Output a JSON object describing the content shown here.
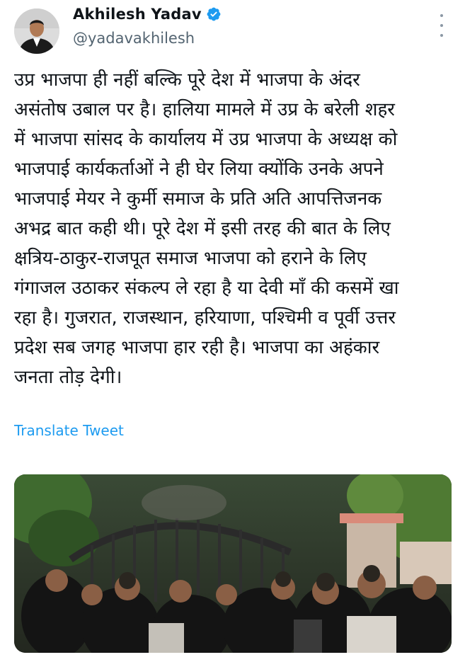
{
  "author": {
    "name": "Akhilesh Yadav",
    "handle": "@yadavakhilesh",
    "verified": true,
    "avatar_icon": "profile-photo"
  },
  "tweet": {
    "text": "उप्र भाजपा ही नहीं बल्कि पूरे देश में भाजपा के अंदर\nअसंतोष उबाल पर है। हालिया मामले में उप्र के बरेली शहर\nमें भाजपा सांसद के कार्यालय में उप्र भाजपा के अध्यक्ष को\nभाजपाई कार्यकर्ताओं ने ही घेर लिया क्योंकि उनके अपने\nभाजपाई मेयर ने कुर्मी समाज के प्रति अति आपत्तिजनक\nअभद्र बात कही थी। पूरे देश में इसी तरह की बात के लिए\nक्षत्रिय-ठाकुर-राजपूत समाज भाजपा को हराने के लिए\nगंगाजल उठाकर संकल्प ले रहा है या देवी माँ की कसमें खा\nरहा है। गुजरात, राजस्थान, हरियाणा, पश्चिमी व पूर्वी उत्तर\nप्रदेश सब जगह भाजपा हार रही है। भाजपा का अहंकार\nजनता तोड़ देगी।",
    "translate_label": "Translate Tweet"
  },
  "icons": {
    "verified": "verified-badge-icon",
    "more": "more-options-icon"
  },
  "colors": {
    "link": "#1d9bf0",
    "verified": "#1d9bf0",
    "secondary_text": "#536471"
  }
}
